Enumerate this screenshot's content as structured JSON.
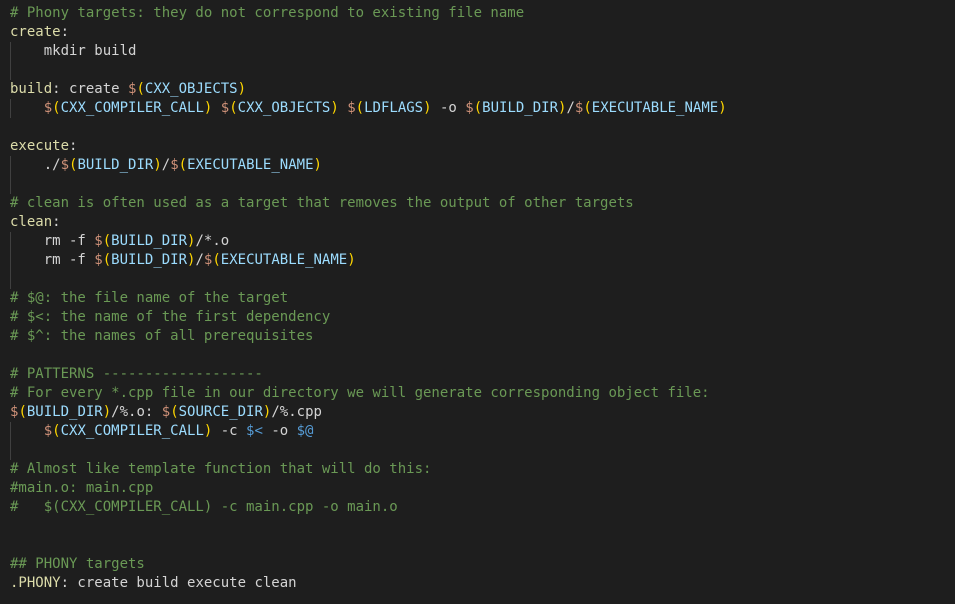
{
  "colors": {
    "background": "#1e1e1e",
    "comment": "#6a9955",
    "target": "#dcdcaa",
    "text": "#d4d4d4",
    "dollar": "#ce9178",
    "paren": "#ffd700",
    "variable": "#9cdcfe",
    "automatic_variable": "#569cd6"
  },
  "lines": [
    {
      "guide": false,
      "tokens": [
        {
          "t": "# Phony targets: they do not correspond to existing file name",
          "k": "comment"
        }
      ]
    },
    {
      "guide": false,
      "tokens": [
        {
          "t": "create",
          "k": "target"
        },
        {
          "t": ":",
          "k": "punct"
        }
      ]
    },
    {
      "guide": true,
      "tokens": [
        {
          "t": "    mkdir build",
          "k": "text"
        }
      ]
    },
    {
      "guide": true,
      "tokens": []
    },
    {
      "guide": false,
      "tokens": [
        {
          "t": "build",
          "k": "target"
        },
        {
          "t": ": create ",
          "k": "text"
        },
        {
          "t": "$",
          "k": "dollar"
        },
        {
          "t": "(",
          "k": "paren"
        },
        {
          "t": "CXX_OBJECTS",
          "k": "var"
        },
        {
          "t": ")",
          "k": "paren"
        }
      ]
    },
    {
      "guide": true,
      "tokens": [
        {
          "t": "    ",
          "k": "text"
        },
        {
          "t": "$",
          "k": "dollar"
        },
        {
          "t": "(",
          "k": "paren"
        },
        {
          "t": "CXX_COMPILER_CALL",
          "k": "var"
        },
        {
          "t": ")",
          "k": "paren"
        },
        {
          "t": " ",
          "k": "text"
        },
        {
          "t": "$",
          "k": "dollar"
        },
        {
          "t": "(",
          "k": "paren"
        },
        {
          "t": "CXX_OBJECTS",
          "k": "var"
        },
        {
          "t": ")",
          "k": "paren"
        },
        {
          "t": " ",
          "k": "text"
        },
        {
          "t": "$",
          "k": "dollar"
        },
        {
          "t": "(",
          "k": "paren"
        },
        {
          "t": "LDFLAGS",
          "k": "var"
        },
        {
          "t": ")",
          "k": "paren"
        },
        {
          "t": " -o ",
          "k": "text"
        },
        {
          "t": "$",
          "k": "dollar"
        },
        {
          "t": "(",
          "k": "paren"
        },
        {
          "t": "BUILD_DIR",
          "k": "var"
        },
        {
          "t": ")",
          "k": "paren"
        },
        {
          "t": "/",
          "k": "text"
        },
        {
          "t": "$",
          "k": "dollar"
        },
        {
          "t": "(",
          "k": "paren"
        },
        {
          "t": "EXECUTABLE_NAME",
          "k": "var"
        },
        {
          "t": ")",
          "k": "paren"
        }
      ]
    },
    {
      "guide": false,
      "tokens": []
    },
    {
      "guide": false,
      "tokens": [
        {
          "t": "execute",
          "k": "target"
        },
        {
          "t": ":",
          "k": "punct"
        }
      ]
    },
    {
      "guide": true,
      "tokens": [
        {
          "t": "    ./",
          "k": "text"
        },
        {
          "t": "$",
          "k": "dollar"
        },
        {
          "t": "(",
          "k": "paren"
        },
        {
          "t": "BUILD_DIR",
          "k": "var"
        },
        {
          "t": ")",
          "k": "paren"
        },
        {
          "t": "/",
          "k": "text"
        },
        {
          "t": "$",
          "k": "dollar"
        },
        {
          "t": "(",
          "k": "paren"
        },
        {
          "t": "EXECUTABLE_NAME",
          "k": "var"
        },
        {
          "t": ")",
          "k": "paren"
        }
      ]
    },
    {
      "guide": true,
      "tokens": []
    },
    {
      "guide": false,
      "tokens": [
        {
          "t": "# clean is often used as a target that removes the output of other targets",
          "k": "comment"
        }
      ]
    },
    {
      "guide": false,
      "tokens": [
        {
          "t": "clean",
          "k": "target"
        },
        {
          "t": ":",
          "k": "punct"
        }
      ]
    },
    {
      "guide": true,
      "tokens": [
        {
          "t": "    rm -f ",
          "k": "text"
        },
        {
          "t": "$",
          "k": "dollar"
        },
        {
          "t": "(",
          "k": "paren"
        },
        {
          "t": "BUILD_DIR",
          "k": "var"
        },
        {
          "t": ")",
          "k": "paren"
        },
        {
          "t": "/*.o",
          "k": "text"
        }
      ]
    },
    {
      "guide": true,
      "tokens": [
        {
          "t": "    rm -f ",
          "k": "text"
        },
        {
          "t": "$",
          "k": "dollar"
        },
        {
          "t": "(",
          "k": "paren"
        },
        {
          "t": "BUILD_DIR",
          "k": "var"
        },
        {
          "t": ")",
          "k": "paren"
        },
        {
          "t": "/",
          "k": "text"
        },
        {
          "t": "$",
          "k": "dollar"
        },
        {
          "t": "(",
          "k": "paren"
        },
        {
          "t": "EXECUTABLE_NAME",
          "k": "var"
        },
        {
          "t": ")",
          "k": "paren"
        }
      ]
    },
    {
      "guide": true,
      "tokens": []
    },
    {
      "guide": false,
      "tokens": [
        {
          "t": "# $@: the file name of the target",
          "k": "comment"
        }
      ]
    },
    {
      "guide": false,
      "tokens": [
        {
          "t": "# $<: the name of the first dependency",
          "k": "comment"
        }
      ]
    },
    {
      "guide": false,
      "tokens": [
        {
          "t": "# $^: the names of all prerequisites",
          "k": "comment"
        }
      ]
    },
    {
      "guide": false,
      "tokens": []
    },
    {
      "guide": false,
      "tokens": [
        {
          "t": "# PATTERNS -------------------",
          "k": "comment"
        }
      ]
    },
    {
      "guide": false,
      "tokens": [
        {
          "t": "# For every *.cpp file in our directory we will generate corresponding object file:",
          "k": "comment"
        }
      ]
    },
    {
      "guide": false,
      "tokens": [
        {
          "t": "$",
          "k": "dollar"
        },
        {
          "t": "(",
          "k": "paren"
        },
        {
          "t": "BUILD_DIR",
          "k": "var"
        },
        {
          "t": ")",
          "k": "paren"
        },
        {
          "t": "/%.o",
          "k": "text"
        },
        {
          "t": ": ",
          "k": "punct"
        },
        {
          "t": "$",
          "k": "dollar"
        },
        {
          "t": "(",
          "k": "paren"
        },
        {
          "t": "SOURCE_DIR",
          "k": "var"
        },
        {
          "t": ")",
          "k": "paren"
        },
        {
          "t": "/%.cpp",
          "k": "text"
        }
      ]
    },
    {
      "guide": true,
      "tokens": [
        {
          "t": "    ",
          "k": "text"
        },
        {
          "t": "$",
          "k": "dollar"
        },
        {
          "t": "(",
          "k": "paren"
        },
        {
          "t": "CXX_COMPILER_CALL",
          "k": "var"
        },
        {
          "t": ")",
          "k": "paren"
        },
        {
          "t": " -c ",
          "k": "text"
        },
        {
          "t": "$<",
          "k": "auto"
        },
        {
          "t": " -o ",
          "k": "text"
        },
        {
          "t": "$@",
          "k": "auto"
        }
      ]
    },
    {
      "guide": true,
      "tokens": []
    },
    {
      "guide": false,
      "tokens": [
        {
          "t": "# Almost like template function that will do this:",
          "k": "comment"
        }
      ]
    },
    {
      "guide": false,
      "tokens": [
        {
          "t": "#main.o: main.cpp",
          "k": "comment"
        }
      ]
    },
    {
      "guide": false,
      "tokens": [
        {
          "t": "#   $(CXX_COMPILER_CALL) -c main.cpp -o main.o",
          "k": "comment"
        }
      ]
    },
    {
      "guide": false,
      "tokens": []
    },
    {
      "guide": false,
      "tokens": []
    },
    {
      "guide": false,
      "tokens": [
        {
          "t": "## PHONY targets",
          "k": "comment"
        }
      ]
    },
    {
      "guide": false,
      "tokens": [
        {
          "t": ".PHONY",
          "k": "target"
        },
        {
          "t": ": create build execute clean",
          "k": "text"
        }
      ]
    }
  ]
}
